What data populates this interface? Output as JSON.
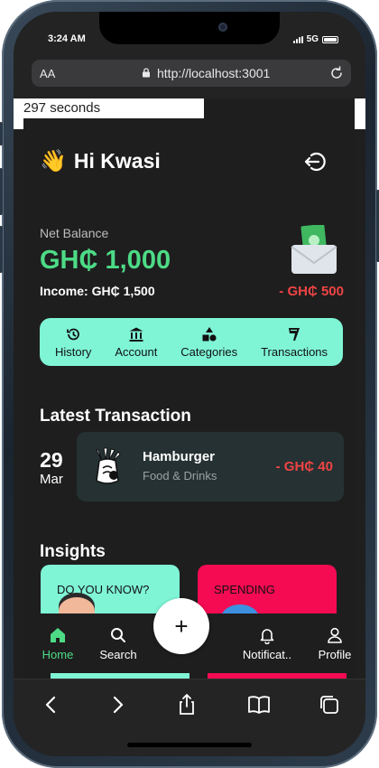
{
  "status_bar": {
    "time": "3:24 AM",
    "network": "5G"
  },
  "browser": {
    "text_size_label": "AA",
    "url": "http://localhost:3001"
  },
  "timer_text": "297 seconds",
  "greeting": {
    "emoji": "👋",
    "text": "Hi Kwasi"
  },
  "balance": {
    "label": "Net Balance",
    "value": "GH₵ 1,000",
    "income": "Income: GH₵ 1,500",
    "expense": "- GH₵ 500"
  },
  "quick_actions": [
    {
      "label": "History",
      "icon": "history-icon"
    },
    {
      "label": "Account",
      "icon": "bank-icon"
    },
    {
      "label": "Categories",
      "icon": "shapes-icon"
    },
    {
      "label": "Transactions",
      "icon": "receipt-icon"
    }
  ],
  "latest_transaction": {
    "section_title": "Latest Transaction",
    "day": "29",
    "month": "Mar",
    "name": "Hamburger",
    "category": "Food & Drinks",
    "amount": "- GH₵ 40"
  },
  "insights": {
    "section_title": "Insights",
    "cards": [
      "DO YOU KNOW?",
      "SPENDING"
    ]
  },
  "bottom_nav": {
    "items": [
      "Home",
      "Search",
      "Notificat..",
      "Profile"
    ],
    "fab": "+"
  },
  "colors": {
    "accent_mint": "#7ff5d6",
    "positive_green": "#4ddb86",
    "negative_red": "#ef4444",
    "insight_red": "#f40b52",
    "background": "#1e1e1e"
  }
}
